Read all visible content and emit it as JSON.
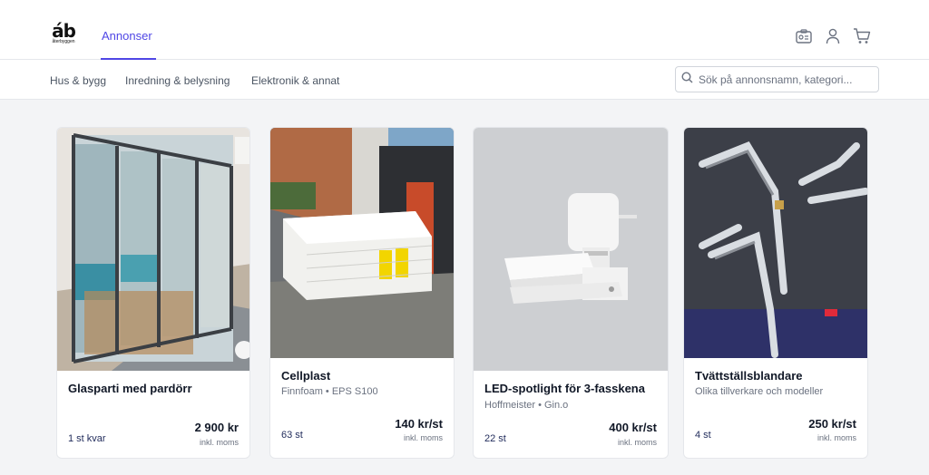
{
  "brand": {
    "logo_mark": "áb",
    "logo_text": "återbyggen"
  },
  "nav": {
    "active_tab": "Annonser"
  },
  "icons": [
    "seller-badge-icon",
    "user-icon",
    "cart-icon"
  ],
  "categories": [
    "Hus & bygg",
    "Inredning & belysning",
    "Elektronik & annat"
  ],
  "search": {
    "placeholder": "Sök på annonsnamn, kategori..."
  },
  "accent": "#4f46e5",
  "listings": [
    {
      "title": "Glasparti med pardörr",
      "subtitle": "",
      "quantity": "1 st kvar",
      "price": "2 900 kr",
      "vat": "inkl. moms"
    },
    {
      "title": "Cellplast",
      "subtitle": "Finnfoam • EPS S100",
      "quantity": "63 st",
      "price": "140 kr/st",
      "vat": "inkl. moms"
    },
    {
      "title": "LED-spotlight för 3-fasskena",
      "subtitle": "Hoffmeister • Gin.o",
      "quantity": "22 st",
      "price": "400 kr/st",
      "vat": "inkl. moms"
    },
    {
      "title": "Tvättställsblandare",
      "subtitle": "Olika tillverkare och modeller",
      "quantity": "4 st",
      "price": "250 kr/st",
      "vat": "inkl. moms"
    }
  ]
}
